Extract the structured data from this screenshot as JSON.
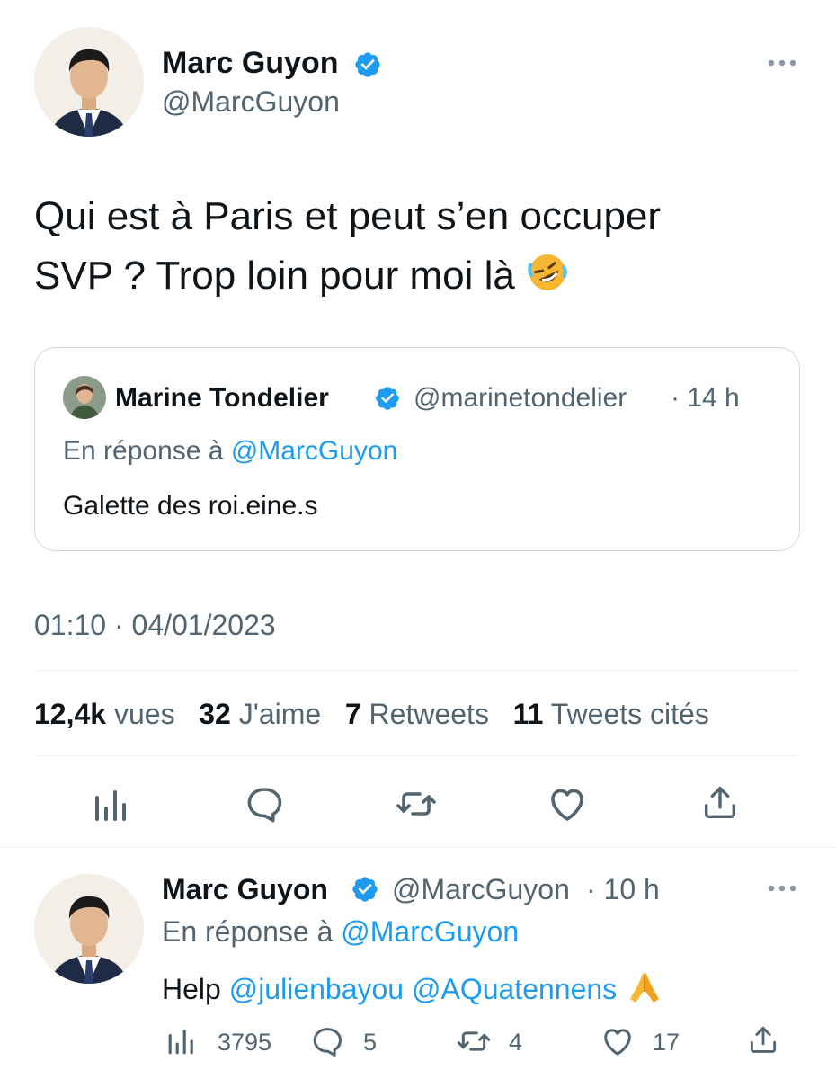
{
  "main_tweet": {
    "author_name": "Marc Guyon",
    "author_handle": "@MarcGuyon",
    "text_line1": "Qui est à Paris et peut s’en occuper",
    "text_line2": "SVP ? Trop loin pour moi là",
    "emoji": "🤣",
    "timestamp": "01:10 · 04/01/2023",
    "stats": {
      "views_count": "12,4k",
      "views_label": "vues",
      "likes_count": "32",
      "likes_label": "J'aime",
      "retweets_count": "7",
      "retweets_label": "Retweets",
      "quotes_count": "11",
      "quotes_label": "Tweets cités"
    }
  },
  "quoted_tweet": {
    "author_name": "Marine Tondelier",
    "author_handle": "@marinetondelier",
    "time": "· 14 h",
    "reply_prefix": "En réponse à",
    "reply_to": "@MarcGuyon",
    "text": "Galette des roi.eine.s"
  },
  "reply_tweet": {
    "author_name": "Marc Guyon",
    "author_handle": "@MarcGuyon",
    "time": "· 10 h",
    "reply_prefix": "En réponse à",
    "reply_to": "@MarcGuyon",
    "text_prefix": "Help",
    "mention1": "@julienbayou",
    "mention2": "@AQuatennens",
    "emoji": "🙏",
    "views": "3795",
    "replies": "5",
    "retweets": "4",
    "likes": "17"
  },
  "colors": {
    "accent": "#1d9bf0",
    "text": "#0f1419",
    "muted": "#536471",
    "border": "#cfd9de"
  }
}
